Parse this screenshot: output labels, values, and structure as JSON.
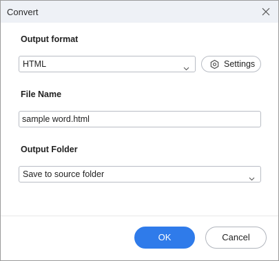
{
  "window": {
    "title": "Convert"
  },
  "output_format": {
    "label": "Output format",
    "selected": "HTML",
    "settings_label": "Settings"
  },
  "file_name": {
    "label": "File Name",
    "value": "sample word.html"
  },
  "output_folder": {
    "label": "Output Folder",
    "selected": "Save to source folder"
  },
  "actions": {
    "ok_label": "OK",
    "cancel_label": "Cancel"
  },
  "colors": {
    "accent": "#2f7bea",
    "titlebar": "#eef1f6",
    "border": "#b8bcc4"
  },
  "icons": {
    "close": "close-icon",
    "chevron": "chevron-down-icon",
    "settings": "gear-icon"
  }
}
